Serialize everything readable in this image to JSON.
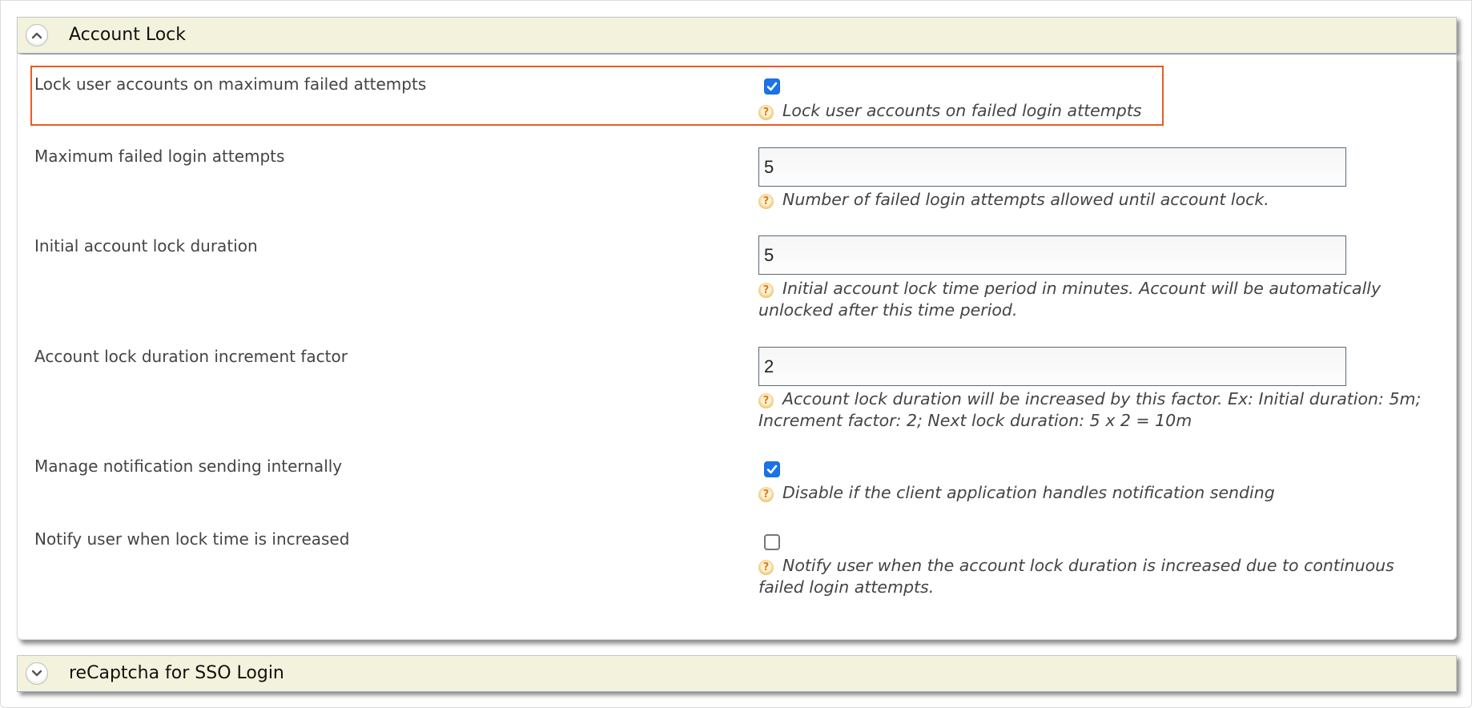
{
  "sections": [
    {
      "title": "Account Lock",
      "expanded": true,
      "toggle_icon": "chevron-up-circle-icon"
    },
    {
      "title": "reCaptcha for SSO Login",
      "expanded": false,
      "toggle_icon": "chevron-down-circle-icon"
    }
  ],
  "settings": {
    "lock_on_failed": {
      "label": "Lock user accounts on maximum failed attempts",
      "type": "checkbox",
      "checked": true,
      "help": "Lock user accounts on failed login attempts",
      "highlighted": true
    },
    "max_failed": {
      "label": "Maximum failed login attempts",
      "type": "text",
      "value": "5",
      "help": "Number of failed login attempts allowed until account lock."
    },
    "initial_duration": {
      "label": "Initial account lock duration",
      "type": "text",
      "value": "5",
      "help": "Initial account lock time period in minutes. Account will be automatically unlocked after this time period."
    },
    "increment_factor": {
      "label": "Account lock duration increment factor",
      "type": "text",
      "value": "2",
      "help": "Account lock duration will be increased by this factor. Ex: Initial duration: 5m; Increment factor: 2; Next lock duration: 5 x 2 = 10m"
    },
    "manage_notification": {
      "label": "Manage notification sending internally",
      "type": "checkbox",
      "checked": true,
      "help": "Disable if the client application handles notification sending"
    },
    "notify_increase": {
      "label": "Notify user when lock time is increased",
      "type": "checkbox",
      "checked": false,
      "help": "Notify user when the account lock duration is increased due to continuous failed login attempts."
    }
  },
  "colors": {
    "header_bg": "#f3f3dd",
    "highlight_border": "#f0591f",
    "checkbox_checked": "#1a73e8",
    "help_icon": "#e07b12"
  },
  "icons": {
    "help": "?",
    "check": "✓"
  }
}
